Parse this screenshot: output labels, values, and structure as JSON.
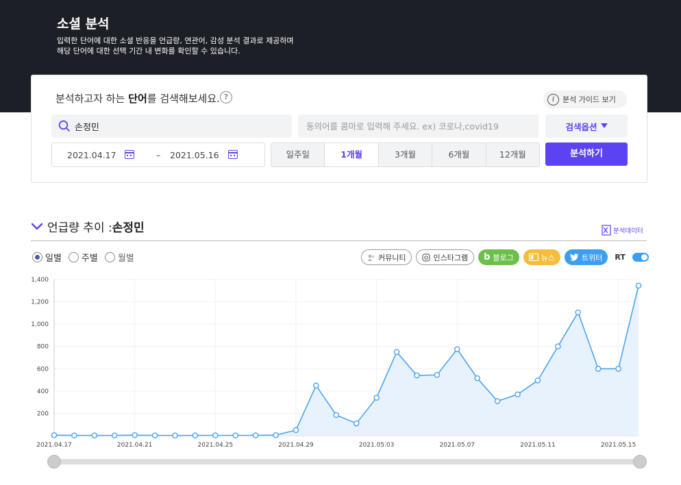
{
  "hero": {
    "title": "소셜 분석",
    "desc1": "입력한 단어에 대한 소셜 반응을 언급량, 연관어, 감성 분석 결과로 제공하며",
    "desc2": "해당 단어에 대한 선택 기간 내 변화를 확인할 수 있습니다."
  },
  "search": {
    "prompt_pre": "분석하고자 하는 ",
    "prompt_bold": "단어",
    "prompt_post": "를 검색해보세요.",
    "help_icon": "?",
    "guide_label": "분석 가이드 보기",
    "keyword": "손정민",
    "exclude_placeholder": "동의어를 콤마로 입력해 주세요. ex) 코로나,covid19",
    "options_label": "검색옵션",
    "start_date": "2021.04.17",
    "date_sep": "–",
    "end_date": "2021.05.16",
    "periods": [
      "일주일",
      "1개월",
      "3개월",
      "6개월",
      "12개월"
    ],
    "active_period": "1개월",
    "analyze_label": "분석하기"
  },
  "section": {
    "title_pre": "언급량 추이 : ",
    "title_keyword": "손정민",
    "export_label": "분석데이터",
    "granularity": [
      "일별",
      "주별",
      "월별"
    ],
    "selected_granularity": "일별",
    "sources": [
      "커뮤니티",
      "인스타그램",
      "블로그",
      "뉴스",
      "트위터"
    ],
    "rt_label": "RT",
    "rt_on": true
  },
  "colors": {
    "accent": "#5b42f3",
    "line": "#4aa3f0",
    "area": "#e6f1fc"
  },
  "chart_data": {
    "type": "area",
    "x": [
      "2021.04.17",
      "2021.04.18",
      "2021.04.19",
      "2021.04.20",
      "2021.04.21",
      "2021.04.22",
      "2021.04.23",
      "2021.04.24",
      "2021.04.25",
      "2021.04.26",
      "2021.04.27",
      "2021.04.28",
      "2021.04.29",
      "2021.04.30",
      "2021.05.01",
      "2021.05.02",
      "2021.05.03",
      "2021.05.04",
      "2021.05.05",
      "2021.05.06",
      "2021.05.07",
      "2021.05.08",
      "2021.05.09",
      "2021.05.10",
      "2021.05.11",
      "2021.05.12",
      "2021.05.13",
      "2021.05.14",
      "2021.05.15",
      "2021.05.16"
    ],
    "values": [
      5,
      2,
      2,
      2,
      5,
      2,
      2,
      2,
      3,
      2,
      3,
      5,
      50,
      450,
      185,
      110,
      340,
      750,
      540,
      545,
      775,
      515,
      310,
      370,
      495,
      800,
      1105,
      600,
      600,
      1345
    ],
    "x_tick_labels": [
      "2021.04.17",
      "2021.04.21",
      "2021.04.25",
      "2021.04.29",
      "2021.05.03",
      "2021.05.07",
      "2021.05.11",
      "2021.05.15"
    ],
    "y_tick_labels": [
      "1,400",
      "1,200",
      "1,000",
      "800",
      "600",
      "400",
      "200"
    ],
    "y_ticks": [
      1400,
      1200,
      1000,
      800,
      600,
      400,
      200
    ],
    "ylim": [
      0,
      1400
    ],
    "grid": true
  }
}
